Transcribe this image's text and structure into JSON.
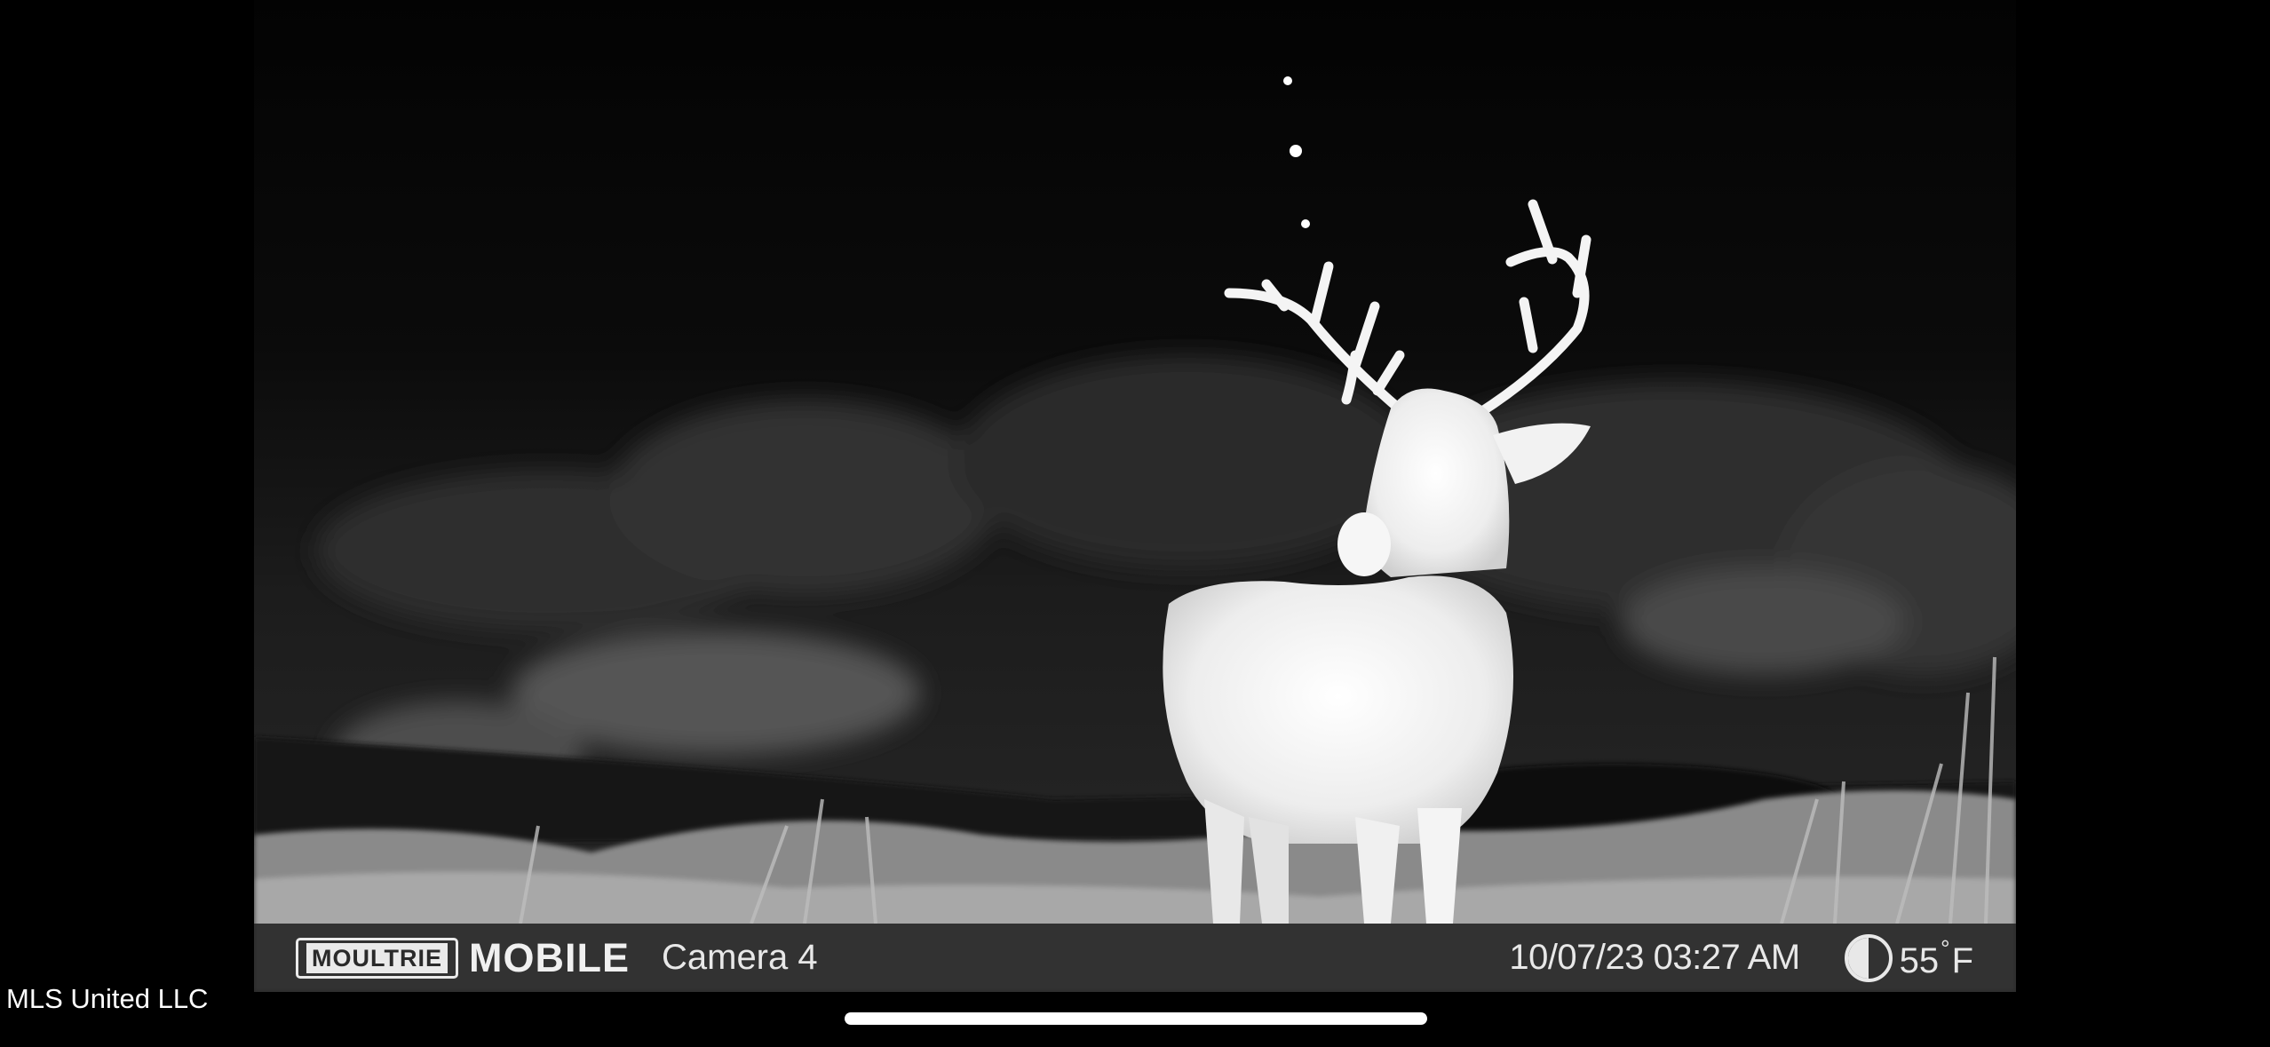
{
  "image": {
    "subject": "white-tailed-deer-buck",
    "style": "infrared-night-grayscale"
  },
  "camera_overlay": {
    "brand_box_text": "MOULTRIE",
    "brand_word": "MOBILE",
    "camera_name": "Camera 4",
    "timestamp": "10/07/23 03:27 AM",
    "moon_icon": "moon-phase-icon",
    "temperature_value": "55",
    "temperature_degree": "°",
    "temperature_unit": "F"
  },
  "watermark": "MLS United LLC",
  "colors": {
    "background": "#000000",
    "overlay_bar": "#282828",
    "text": "#f2f2f2"
  }
}
